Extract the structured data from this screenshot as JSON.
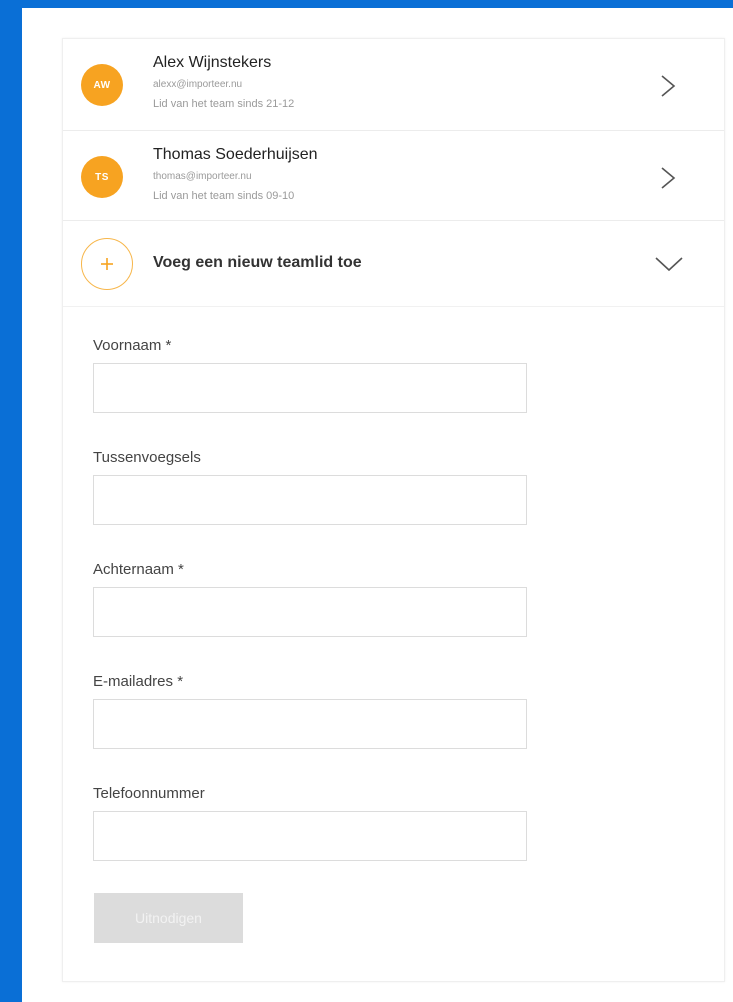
{
  "team": {
    "members": [
      {
        "initials": "AW",
        "name": "Alex Wijnstekers",
        "email": "alexx@importeer.nu",
        "since": "Lid van het team sinds 21-12"
      },
      {
        "initials": "TS",
        "name": "Thomas Soederhuijsen",
        "email": "thomas@importeer.nu",
        "since": "Lid van het team sinds 09-10"
      }
    ],
    "add_label": "Voeg een nieuw teamlid toe"
  },
  "form": {
    "first_name_label": "Voornaam *",
    "first_name_value": "",
    "infix_label": "Tussenvoegsels",
    "infix_value": "",
    "last_name_label": "Achternaam *",
    "last_name_value": "",
    "email_label": "E-mailadres *",
    "email_value": "",
    "phone_label": "Telefoonnummer",
    "phone_value": "",
    "submit_label": "Uitnodigen"
  },
  "colors": {
    "background": "#0a6fd6",
    "avatar": "#f7a321",
    "add_circle": "#f7b64a",
    "button_disabled": "#dcdcdc"
  },
  "icons": {
    "member_chevron": "chevron-right-icon",
    "add": "plus-icon",
    "expand": "chevron-down-icon"
  }
}
